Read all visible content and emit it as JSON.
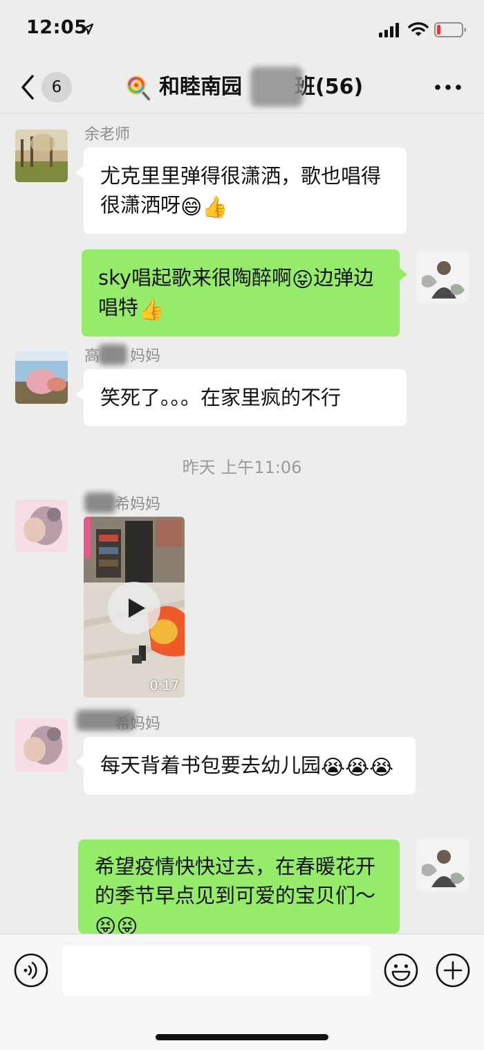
{
  "status_bar": {
    "time": "12:05"
  },
  "nav": {
    "unread_count": "6",
    "title_prefix": "和睦南园",
    "title_suffix": "班(56)"
  },
  "messages": [
    {
      "id": "m1",
      "direction": "in",
      "sender": "余老师",
      "text": "尤克里里弹得很潇洒，歌也唱得很潇洒呀",
      "emojis": [
        "😄",
        "👍"
      ]
    },
    {
      "id": "m2",
      "direction": "out",
      "text": "sky唱起歌来很陶醉啊",
      "emoji_mid": "😝",
      "text_after": "边弹边唱特",
      "emojis": [
        "👍"
      ]
    },
    {
      "id": "m3",
      "direction": "in",
      "sender": "高",
      "sender_suffix": "妈妈",
      "text": "笑死了。。。在家里疯的不行"
    },
    {
      "id": "ts1",
      "type": "timestamp",
      "text": "昨天 上午11:06"
    },
    {
      "id": "m4",
      "direction": "in",
      "type": "video",
      "sender_suffix": "希妈妈",
      "duration": "0:17"
    },
    {
      "id": "m5",
      "direction": "in",
      "sender_suffix": "希妈妈",
      "text": "每天背着书包要去幼儿园",
      "emojis": [
        "😭",
        "😭",
        "😭"
      ]
    },
    {
      "id": "m6",
      "direction": "out",
      "text": "希望疫情快快过去，在春暖花开的季节早点见到可爱的宝贝们～",
      "emojis": [
        "😝",
        "😝"
      ]
    }
  ],
  "input": {
    "placeholder": ""
  },
  "colors": {
    "background": "#ededed",
    "incoming_bubble": "#ffffff",
    "outgoing_bubble": "#95ec69",
    "badge": "#d5d5d5"
  },
  "icons": [
    "location-arrow-icon",
    "signal-icon",
    "wifi-icon",
    "battery-icon",
    "back-chevron-icon",
    "lollipop-icon",
    "more-dots-icon",
    "play-icon",
    "voice-icon",
    "emoji-face-icon",
    "plus-icon"
  ]
}
